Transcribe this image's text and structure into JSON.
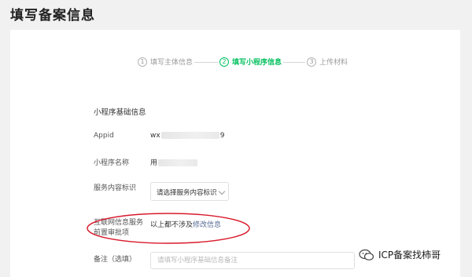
{
  "page": {
    "title": "填写备案信息"
  },
  "steps": [
    {
      "num": "1",
      "label": "填写主体信息"
    },
    {
      "num": "2",
      "label": "填写小程序信息"
    },
    {
      "num": "3",
      "label": "上传材料"
    }
  ],
  "form": {
    "section_title": "小程序基础信息",
    "appid": {
      "label": "Appid",
      "value_prefix": "wx",
      "value_suffix": "9"
    },
    "app_name": {
      "label": "小程序名称",
      "value_prefix": "用"
    },
    "service_tag": {
      "label": "服务内容标识",
      "placeholder": "请选择服务内容标识"
    },
    "pre_approval": {
      "label_line1": "互联网信息服务",
      "label_line2": "前置审批项",
      "value": "以上都不涉及",
      "edit_link": "修改信息"
    },
    "remark": {
      "label": "备注（选填）",
      "placeholder": "请填写小程序基础信息备注"
    }
  },
  "watermark": {
    "text": "ICP备案找柿哥"
  },
  "colors": {
    "accent": "#07c160",
    "link": "#576b95",
    "annotation": "#d9192b"
  }
}
